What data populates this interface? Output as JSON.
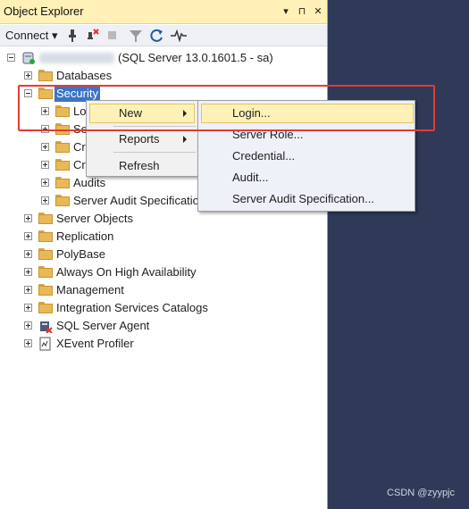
{
  "window": {
    "title": "Object Explorer",
    "title_buttons": [
      "▾",
      "⊓",
      "✕"
    ]
  },
  "toolbar": {
    "connect_label": "Connect",
    "icons": [
      "connect-icon",
      "disconnect-icon",
      "stop-icon",
      "filter-icon",
      "refresh-icon",
      "activity-monitor-icon"
    ]
  },
  "tree": {
    "server_label": "(SQL Server 13.0.1601.5 - sa)",
    "databases": "Databases",
    "security": "Security",
    "security_children": [
      "Lo",
      "Se",
      "Cr",
      "Cr",
      "Audits",
      "Server Audit Specificatio"
    ],
    "server_objects": "Server Objects",
    "replication": "Replication",
    "polybase": "PolyBase",
    "always_on": "Always On High Availability",
    "management": "Management",
    "integration": "Integration Services Catalogs",
    "agent": "SQL Server Agent",
    "xevent": "XEvent Profiler"
  },
  "context_menu": {
    "new": "New",
    "reports": "Reports",
    "refresh": "Refresh"
  },
  "submenu": {
    "items": [
      "Login...",
      "Server Role...",
      "Credential...",
      "Audit...",
      "Server Audit Specification..."
    ]
  },
  "watermark": "CSDN @zyypjc",
  "colors": {
    "highlight": "#fff1b7",
    "selection": "#3a74c9",
    "annotation": "#e53b30",
    "background_right": "#2e3a58"
  }
}
